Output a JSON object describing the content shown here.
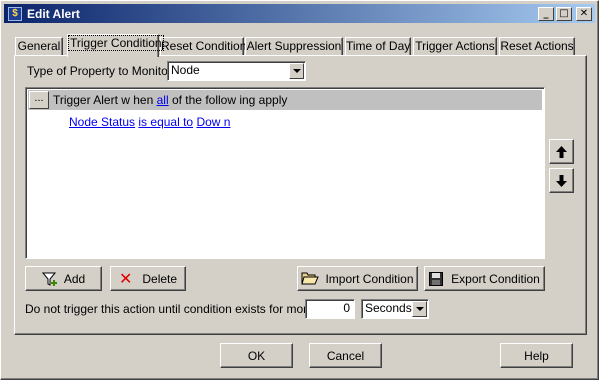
{
  "window": {
    "title": "Edit Alert",
    "controls": {
      "minimize": "_",
      "maximize": "□",
      "close": "✕"
    }
  },
  "tabs": [
    {
      "label": "General",
      "active": false
    },
    {
      "label": "Trigger Condition",
      "active": true
    },
    {
      "label": "Reset Condition",
      "active": false
    },
    {
      "label": "Alert Suppression",
      "active": false
    },
    {
      "label": "Time of Day",
      "active": false
    },
    {
      "label": "Trigger Actions",
      "active": false
    },
    {
      "label": "Reset Actions",
      "active": false
    }
  ],
  "property": {
    "label": "Type of Property to Monitor:",
    "value": "Node"
  },
  "condition": {
    "ellipsis": "...",
    "header_prefix": "Trigger Alert w hen ",
    "header_link": "all",
    "header_suffix": " of the follow ing apply",
    "field": "Node Status",
    "operator": "is equal to",
    "value": "Dow n"
  },
  "side_buttons": {
    "up_icon": "arrow-up-icon",
    "down_icon": "arrow-down-icon"
  },
  "actions": {
    "add_label": "Add",
    "delete_label": "Delete",
    "import_label": "Import Condition",
    "export_label": "Export Condition"
  },
  "delay": {
    "label": "Do not trigger this action until condition exists for more than",
    "value": "0",
    "unit": "Seconds"
  },
  "footer": {
    "ok_label": "OK",
    "cancel_label": "Cancel",
    "help_label": "Help"
  }
}
